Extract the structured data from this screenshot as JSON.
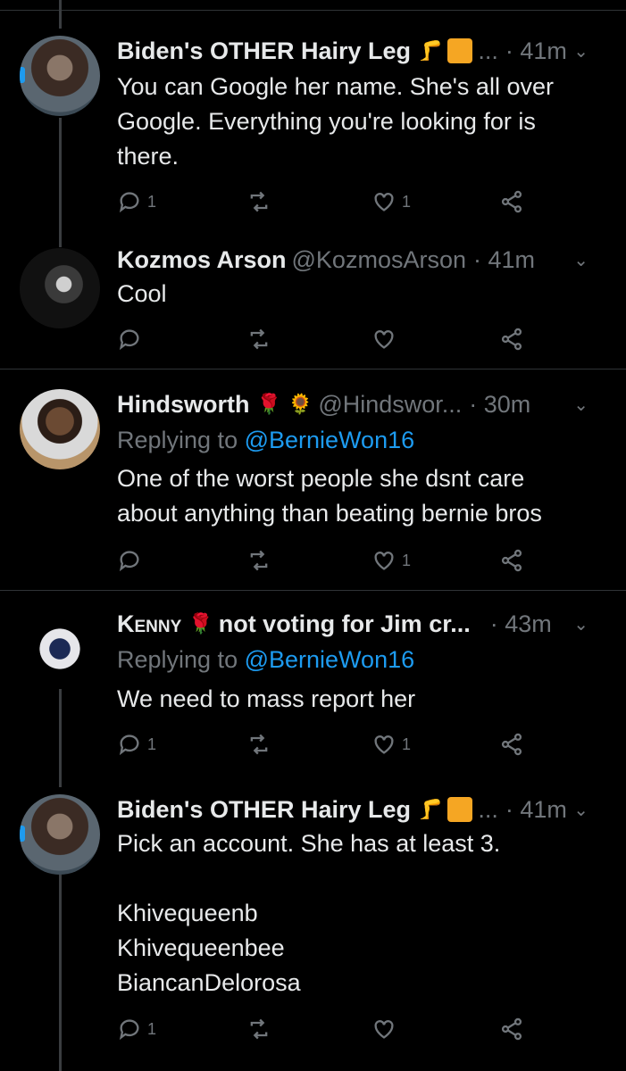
{
  "tweets": [
    {
      "name": "Biden's OTHER Hairy Leg",
      "handle": "...",
      "time": "· 41m",
      "reply_to_prefix": "",
      "reply_to": "",
      "text": "You can Google her name. She's all over\nGoogle. Everything you're looking for is\nthere.",
      "emojis": [
        "leg-emoji",
        "construction-worker-emoji"
      ],
      "replies": "1",
      "retweets": "",
      "likes": "1"
    },
    {
      "name": "Kozmos Arson",
      "handle": "@KozmosArson",
      "time": "· 41m",
      "text": "Cool",
      "replies": "",
      "retweets": "",
      "likes": ""
    },
    {
      "name": "Hindsworth",
      "handle": "@Hindswor...",
      "time": "· 30m",
      "reply_to_prefix": "Replying to",
      "reply_to": "@BernieWon16",
      "text": "One of the worst people she dsnt care\nabout anything than beating bernie bros",
      "emojis": [
        "rose-emoji",
        "sunflower-emoji"
      ],
      "replies": "",
      "retweets": "",
      "likes": "1"
    },
    {
      "name": "Kenny",
      "name_suffix": "not voting for Jim cr...",
      "time": "· 43m",
      "reply_to_prefix": "Replying to",
      "reply_to": "@BernieWon16",
      "text": "We need to mass report her",
      "emojis": [
        "rose-emoji"
      ],
      "replies": "1",
      "retweets": "",
      "likes": "1"
    },
    {
      "name": "Biden's OTHER Hairy Leg",
      "handle": "...",
      "time": "· 41m",
      "text": "Pick an account. She has at least 3.\n\nKhivequeenb\nKhivequeenbee\nBiancanDelorosa",
      "emojis": [
        "leg-emoji",
        "construction-worker-emoji"
      ],
      "replies": "1",
      "retweets": "",
      "likes": ""
    }
  ],
  "colors": {
    "background": "#000000",
    "text": "#e7e9ea",
    "muted": "#71767b",
    "link": "#1d9bf0",
    "divider": "#2f3336"
  }
}
